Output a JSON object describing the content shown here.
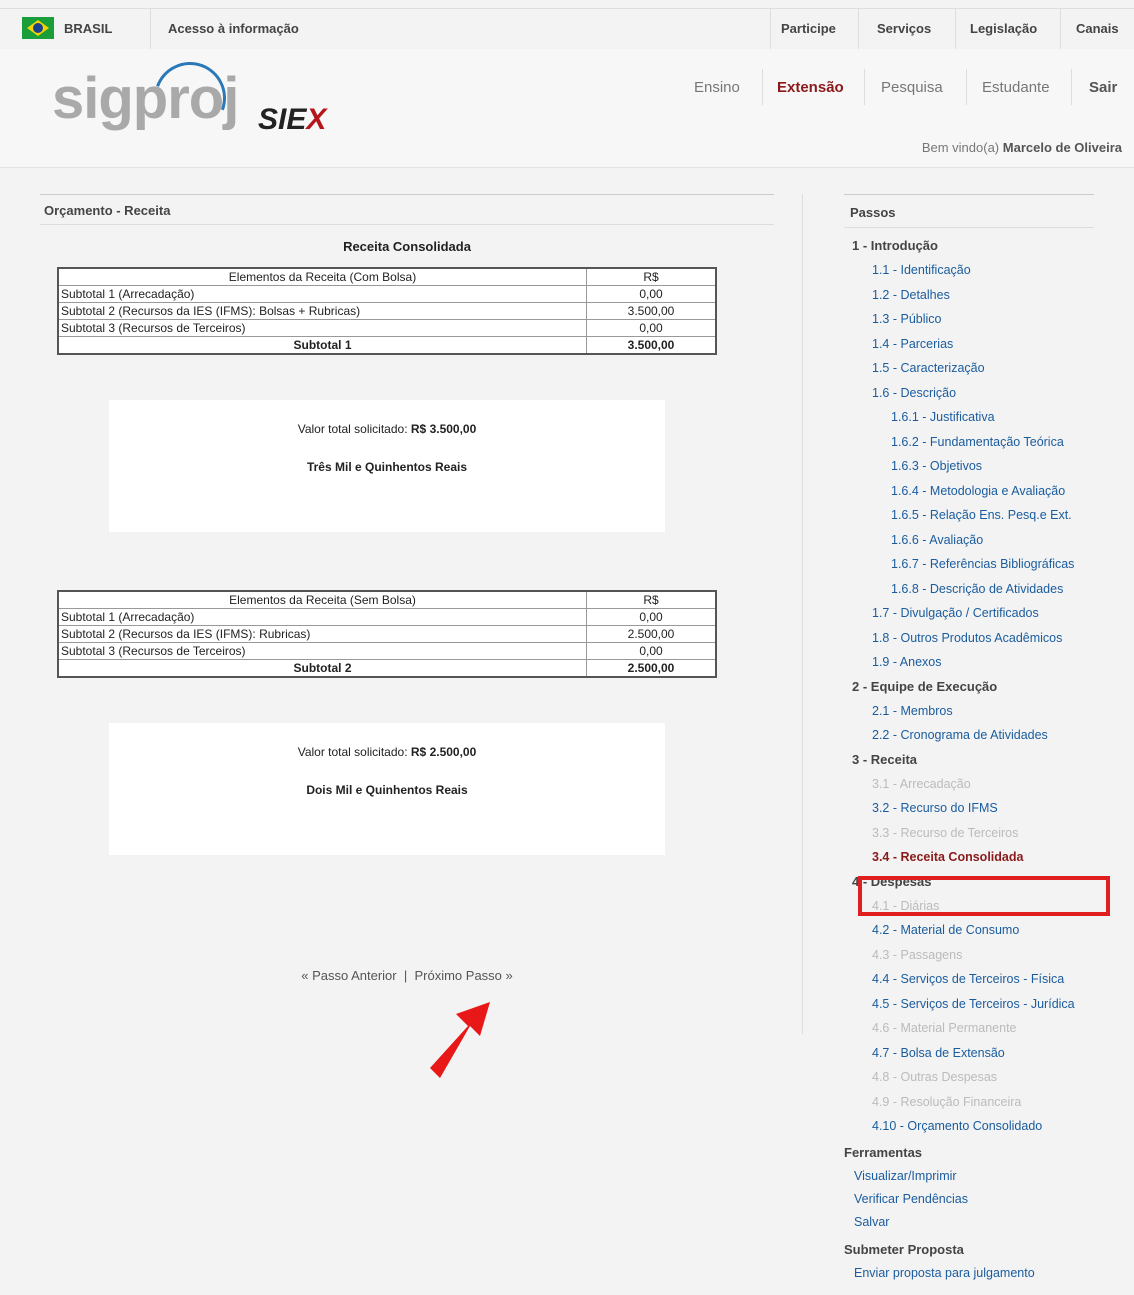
{
  "govbar": {
    "brasil": "BRASIL",
    "acesso": "Acesso à informação",
    "links": [
      "Participe",
      "Serviços",
      "Legislação",
      "Canais"
    ]
  },
  "header": {
    "logo": "sigproj",
    "siex": "SIEX",
    "nav": [
      "Ensino",
      "Extensão",
      "Pesquisa",
      "Estudante",
      "Sair"
    ],
    "active_nav": "Extensão",
    "welcome_prefix": "Bem vindo(a)",
    "user_name": "Marcelo de Oliveira"
  },
  "main": {
    "section_title": "Orçamento - Receita",
    "receita_title": "Receita Consolidada",
    "table_com_bolsa": {
      "header": [
        "Elementos da Receita (Com Bolsa)",
        "R$"
      ],
      "rows": [
        [
          "Subtotal 1 (Arrecadação)",
          "0,00"
        ],
        [
          "Subtotal 2 (Recursos da IES (IFMS): Bolsas + Rubricas)",
          "3.500,00"
        ],
        [
          "Subtotal 3 (Recursos de Terceiros)",
          "0,00"
        ]
      ],
      "total": [
        "Subtotal 1",
        "3.500,00"
      ]
    },
    "valor1": {
      "label": "Valor total solicitado:",
      "value": "R$ 3.500,00",
      "extenso": "Três Mil e Quinhentos Reais"
    },
    "table_sem_bolsa": {
      "header": [
        "Elementos da Receita (Sem Bolsa)",
        "R$"
      ],
      "rows": [
        [
          "Subtotal 1 (Arrecadação)",
          "0,00"
        ],
        [
          "Subtotal 2 (Recursos da IES (IFMS): Rubricas)",
          "2.500,00"
        ],
        [
          "Subtotal 3 (Recursos de Terceiros)",
          "0,00"
        ]
      ],
      "total": [
        "Subtotal 2",
        "2.500,00"
      ]
    },
    "valor2": {
      "label": "Valor total solicitado:",
      "value": "R$ 2.500,00",
      "extenso": "Dois Mil e Quinhentos Reais"
    },
    "pager": {
      "prev": "« Passo Anterior",
      "sep": "|",
      "next": "Próximo Passo »"
    }
  },
  "sidebar": {
    "title": "Passos",
    "groups": [
      {
        "label": "1 - Introdução",
        "items": [
          {
            "label": "1.1 - Identificação",
            "state": "link"
          },
          {
            "label": "1.2 - Detalhes",
            "state": "link"
          },
          {
            "label": "1.3 - Público",
            "state": "link"
          },
          {
            "label": "1.4 - Parcerias",
            "state": "link"
          },
          {
            "label": "1.5 - Caracterização",
            "state": "link"
          },
          {
            "label": "1.6 - Descrição",
            "state": "link"
          },
          {
            "label": "1.6.1 - Justificativa",
            "state": "link",
            "sub": true
          },
          {
            "label": "1.6.2 - Fundamentação Teórica",
            "state": "link",
            "sub": true
          },
          {
            "label": "1.6.3 - Objetivos",
            "state": "link",
            "sub": true
          },
          {
            "label": "1.6.4 - Metodologia e Avaliação",
            "state": "link",
            "sub": true
          },
          {
            "label": "1.6.5 - Relação Ens. Pesq.e Ext.",
            "state": "link",
            "sub": true
          },
          {
            "label": "1.6.6 - Avaliação",
            "state": "link",
            "sub": true
          },
          {
            "label": "1.6.7 - Referências Bibliográficas",
            "state": "link",
            "sub": true
          },
          {
            "label": "1.6.8 - Descrição de Atividades",
            "state": "link",
            "sub": true
          },
          {
            "label": "1.7 - Divulgação / Certificados",
            "state": "link"
          },
          {
            "label": "1.8 - Outros Produtos Acadêmicos",
            "state": "link"
          },
          {
            "label": "1.9 - Anexos",
            "state": "link"
          }
        ]
      },
      {
        "label": "2 - Equipe de Execução",
        "items": [
          {
            "label": "2.1 - Membros",
            "state": "link"
          },
          {
            "label": "2.2 - Cronograma de Atividades",
            "state": "link"
          }
        ]
      },
      {
        "label": "3 - Receita",
        "items": [
          {
            "label": "3.1 - Arrecadação",
            "state": "disabled"
          },
          {
            "label": "3.2 - Recurso do IFMS",
            "state": "link"
          },
          {
            "label": "3.3 - Recurso de Terceiros",
            "state": "disabled"
          },
          {
            "label": "3.4 - Receita Consolidada",
            "state": "current"
          }
        ]
      },
      {
        "label": "4 - Despesas",
        "items": [
          {
            "label": "4.1 - Diárias",
            "state": "disabled"
          },
          {
            "label": "4.2 - Material de Consumo",
            "state": "link"
          },
          {
            "label": "4.3 - Passagens",
            "state": "disabled"
          },
          {
            "label": "4.4 - Serviços de Terceiros - Física",
            "state": "link"
          },
          {
            "label": "4.5 - Serviços de Terceiros - Jurídica",
            "state": "link"
          },
          {
            "label": "4.6 - Material Permanente",
            "state": "disabled"
          },
          {
            "label": "4.7 - Bolsa de Extensão",
            "state": "link"
          },
          {
            "label": "4.8 - Outras Despesas",
            "state": "disabled"
          },
          {
            "label": "4.9 - Resolução Financeira",
            "state": "disabled"
          },
          {
            "label": "4.10 - Orçamento Consolidado",
            "state": "link"
          }
        ]
      }
    ],
    "tools_title": "Ferramentas",
    "tools": [
      "Visualizar/Imprimir",
      "Verificar Pendências",
      "Salvar"
    ],
    "submit_title": "Submeter Proposta",
    "submit_link": "Enviar proposta para julgamento"
  },
  "colors": {
    "accent": "#8b1a1a",
    "link": "#1a5c9e",
    "disabled": "#bbbbbb",
    "highlight": "#e02020"
  }
}
